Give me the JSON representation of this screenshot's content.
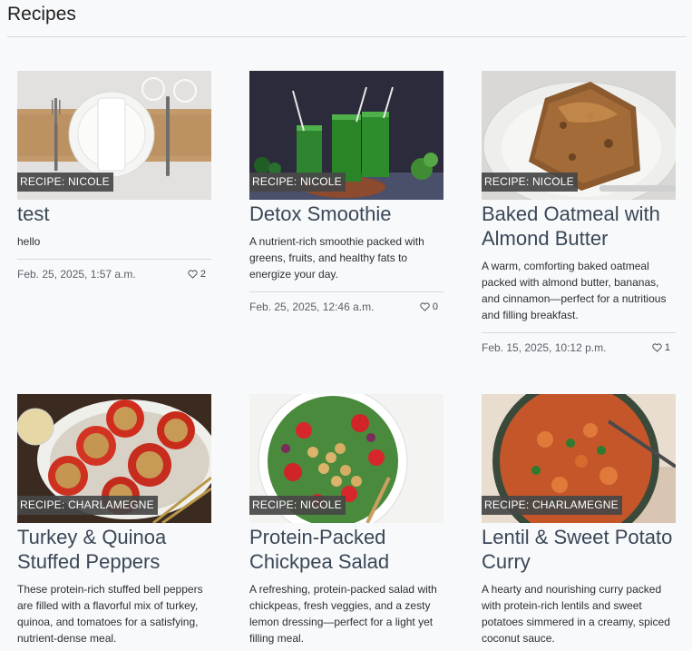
{
  "page": {
    "title": "Recipes"
  },
  "recipes": [
    {
      "badge": "RECIPE: NICOLE",
      "title": "test",
      "description": "hello",
      "date": "Feb. 25, 2025, 1:57 a.m.",
      "likes": "2",
      "image": "table-setting"
    },
    {
      "badge": "RECIPE: NICOLE",
      "title": "Detox Smoothie",
      "description": "A nutrient-rich smoothie packed with greens, fruits, and healthy fats to energize your day.",
      "date": "Feb. 25, 2025, 12:46 a.m.",
      "likes": "0",
      "image": "green-smoothies"
    },
    {
      "badge": "RECIPE: NICOLE",
      "title": "Baked Oatmeal with Almond Butter",
      "description": "A warm, comforting baked oatmeal packed with almond butter, bananas, and cinnamon—perfect for a nutritious and filling breakfast.",
      "date": "Feb. 15, 2025, 10:12 p.m.",
      "likes": "1",
      "image": "baked-oatmeal"
    },
    {
      "badge": "RECIPE: CHARLAMEGNE",
      "title": "Turkey & Quinoa Stuffed Peppers",
      "description": "These protein-rich stuffed bell peppers are filled with a flavorful mix of turkey, quinoa, and tomatoes for a satisfying, nutrient-dense meal.",
      "image": "stuffed-peppers"
    },
    {
      "badge": "RECIPE: NICOLE",
      "title": "Protein-Packed Chickpea Salad",
      "description": "A refreshing, protein-packed salad with chickpeas, fresh veggies, and a zesty lemon dressing—perfect for a light yet filling meal.",
      "image": "chickpea-salad"
    },
    {
      "badge": "RECIPE: CHARLAMEGNE",
      "title": "Lentil & Sweet Potato Curry",
      "description": "A hearty and nourishing curry packed with protein-rich lentils and sweet potatoes simmered in a creamy, spiced coconut sauce.",
      "image": "lentil-curry"
    }
  ]
}
